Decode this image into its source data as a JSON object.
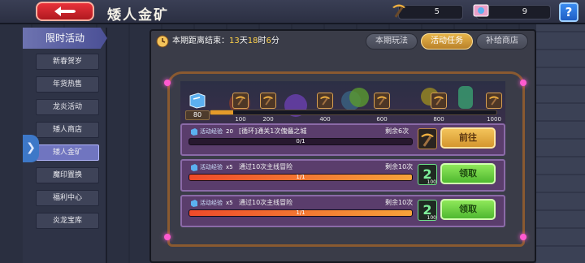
{
  "header": {
    "title": "矮人金矿",
    "resources": [
      {
        "icon": "pickaxe-icon",
        "value": "5"
      },
      {
        "icon": "gem-icon",
        "value": "9"
      }
    ],
    "help_label": "?"
  },
  "sidebar": {
    "heading": "限时活动",
    "items": [
      {
        "label": "新春贺岁",
        "active": false
      },
      {
        "label": "年货热售",
        "active": false
      },
      {
        "label": "龙炎活动",
        "active": false
      },
      {
        "label": "矮人商店",
        "active": false
      },
      {
        "label": "矮人金矿",
        "active": true
      },
      {
        "label": "魔印置换",
        "active": false
      },
      {
        "label": "福利中心",
        "active": false
      },
      {
        "label": "炎龙宝库",
        "active": false
      }
    ]
  },
  "panel": {
    "timer_prefix": "本期距离结束：",
    "timer_days": "13",
    "timer_days_unit": "天",
    "timer_hours": "18",
    "timer_hours_unit": "时",
    "timer_minutes": "6",
    "timer_minutes_unit": "分",
    "tabs": [
      {
        "label": "本期玩法",
        "active": false
      },
      {
        "label": "活动任务",
        "active": true
      },
      {
        "label": "补给商店",
        "active": false
      }
    ]
  },
  "milestones": {
    "current_progress": "80",
    "max_value": 1000,
    "current_value": 80,
    "points": [
      {
        "label": "100"
      },
      {
        "label": "200"
      },
      {
        "label": "400"
      },
      {
        "label": "600"
      },
      {
        "label": "800"
      },
      {
        "label": "1000"
      }
    ]
  },
  "tasks": [
    {
      "reward_label": "活动经验",
      "reward_qty": "20",
      "name": "[循环]通关1次傀儡之城",
      "remaining": "剩余6次",
      "progress_text": "0/1",
      "progress_fraction": 0,
      "item_qty": "",
      "item_type": "pickaxe",
      "button_label": "前往",
      "button_type": "go"
    },
    {
      "reward_label": "活动经验",
      "reward_qty": "x5",
      "name": "通过10次主线冒险",
      "remaining": "剩余10次",
      "progress_text": "1/1",
      "progress_fraction": 1,
      "item_qty": "100",
      "item_type": "token",
      "button_label": "领取",
      "button_type": "claim"
    },
    {
      "reward_label": "活动经验",
      "reward_qty": "x5",
      "name": "通过10次主线冒险",
      "remaining": "剩余10次",
      "progress_text": "1/1",
      "progress_fraction": 1,
      "item_qty": "100",
      "item_type": "token",
      "button_label": "领取",
      "button_type": "claim"
    }
  ],
  "colors": {
    "accent_gold": "#e7b54a",
    "claim_green": "#4fb830",
    "progress_orange": "#f7a33a",
    "task_purple": "#5a3d6c"
  }
}
